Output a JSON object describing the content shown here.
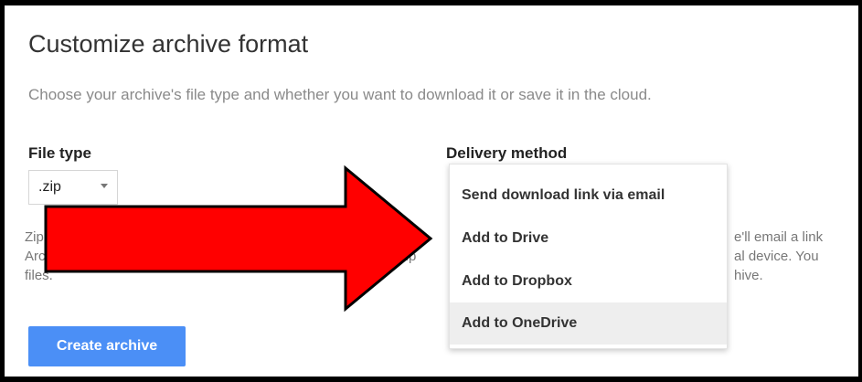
{
  "dialog": {
    "title": "Customize archive format",
    "subtitle": "Choose your archive's file type and whether you want to download it or save it in the cloud."
  },
  "file_type": {
    "label": "File type",
    "selected": ".zip",
    "desc_lines": [
      "Zip",
      "Arc",
      "files."
    ],
    "desc_fragment": ".zip"
  },
  "delivery": {
    "label": "Delivery method",
    "desc_lines": [
      "e'll email a link",
      "al device. You",
      "hive."
    ],
    "options": [
      {
        "label": "Send download link via email"
      },
      {
        "label": "Add to Drive"
      },
      {
        "label": "Add to Dropbox"
      },
      {
        "label": "Add to OneDrive",
        "highlighted": true
      }
    ]
  },
  "create_button": {
    "label": "Create archive"
  },
  "colors": {
    "button": "#4b8ff6",
    "arrow_fill": "#ff0000",
    "arrow_stroke": "#000000"
  }
}
